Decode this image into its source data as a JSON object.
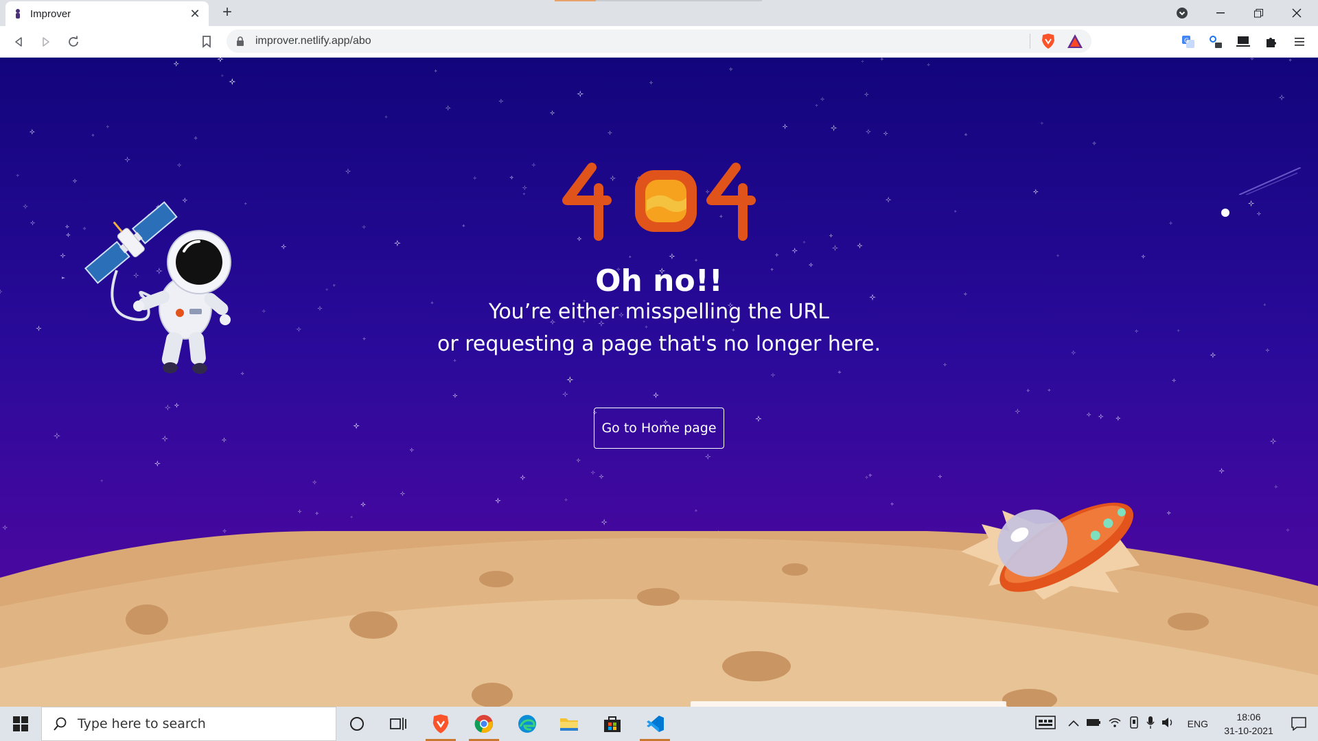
{
  "browser": {
    "tab_title": "Improver",
    "url": "improver.netlify.app/abo"
  },
  "page": {
    "error_code": "404",
    "heading": "Oh no!!",
    "message_line1": "You’re either misspelling the URL",
    "message_line2": "or requesting a page that's no longer here.",
    "home_button_label": "Go to Home page"
  },
  "taskbar": {
    "search_placeholder": "Type here to search",
    "language": "ENG",
    "time": "18:06",
    "date": "31-10-2021"
  },
  "colors": {
    "sky_top": "#12057c",
    "sky_bottom": "#53089e",
    "ground": "#e3b07f",
    "accent_orange": "#e2541b"
  }
}
